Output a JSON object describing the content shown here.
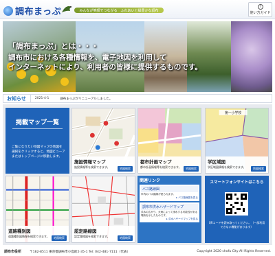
{
  "header": {
    "logo": "調布まっぷ",
    "tagline": "みんなが笑顔でつながる　ふれあいと緑豊かな調布",
    "guide_label": "使い方ガイド"
  },
  "hero": {
    "title": "「調布まっぷ」とは・・・",
    "lines": [
      "調布市における各種情報を、電子地図を利用して",
      "インターネットにより、利用者の皆様に提供するものです。"
    ]
  },
  "news": {
    "heading": "お知らせ",
    "date": "2021-4-1",
    "text": "調布まっぷがリニューアルしました。"
  },
  "catalog": {
    "title": "掲載マップ一覧",
    "desc": "ご覧になりたい地図マップの地図を選択をクリックすると、地図ビューアまたはトップページに移動します。"
  },
  "tiles": [
    {
      "title": "施設情報マップ",
      "desc": "施設情報等を検索できます。",
      "btn": "地図検索"
    },
    {
      "title": "都市計画マップ",
      "desc": "都市計画情報等を検索できます。",
      "btn": "地図検索"
    },
    {
      "title": "学区域図",
      "desc": "学区域図情報を検索できます。",
      "btn": "地図検索",
      "label": "第一小学校"
    },
    {
      "title": "道路種別図",
      "desc": "道路種別図情報を検索できます。",
      "btn": "地図検索"
    },
    {
      "title": "認定路線図",
      "desc": "認定路線図を検索できます。",
      "btn": "地図検索"
    }
  ],
  "links": {
    "heading": "関連リンク",
    "items": [
      {
        "label": "バス路線図",
        "desc": "市内のバス路線が見られます。",
        "more": "▸ バス路線図を見る"
      },
      {
        "label": "調布市洪水ハザードマップ",
        "desc": "洪水の広がり、大雨によって浸水する可能性がある場所を示したものです。",
        "more": "▸ 洪水ハザードマップを見る"
      }
    ]
  },
  "smartphone": {
    "heading": "スマートフォンサイトはこちら",
    "desc": "QRコードを読み取ってください。（一部利用できない機能があります）"
  },
  "footer": {
    "org": "調布市役所",
    "address": "〒182-8511 東京都調布市小島町2-35-1  Tel: 042-481-7111（代表）",
    "copyright": "Copyright 2020 chofu City All Rights Reserved."
  },
  "colors": {
    "primary": "#1f63b8",
    "accent": "#2d74c4",
    "header_text": "#1f4fa8"
  }
}
